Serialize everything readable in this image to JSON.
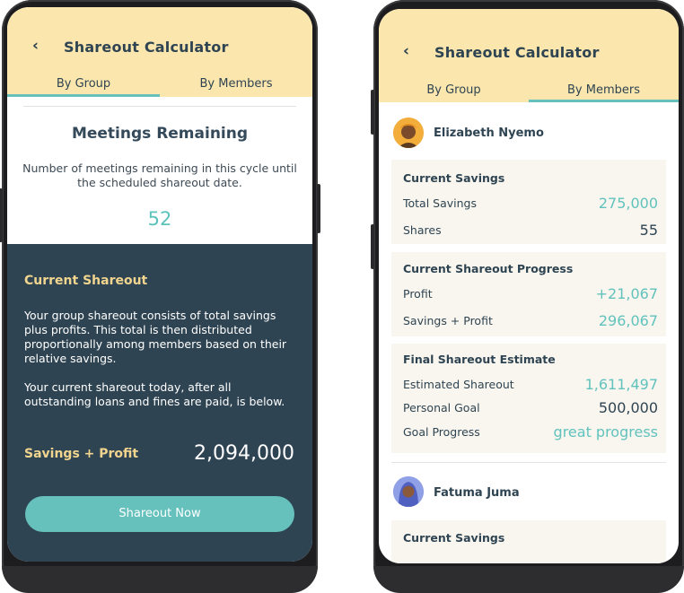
{
  "left_screen": {
    "header": {
      "title": "Shareout Calculator"
    },
    "tabs": [
      {
        "label": "By Group"
      },
      {
        "label": "By Members"
      }
    ],
    "meetings": {
      "title": "Meetings Remaining",
      "description": "Number of meetings remaining in this cycle until the scheduled shareout date.",
      "value": "52"
    },
    "current_shareout": {
      "title": "Current Shareout",
      "paragraph1": "Your group shareout consists of total savings plus profits. This total is then distributed proportionally among members based on their relative savings.",
      "paragraph2": "Your current shareout today, after all outstanding loans and fines are paid, is below.",
      "label": "Savings + Profit",
      "value": "2,094,000"
    },
    "cta": {
      "label": "Shareout Now"
    }
  },
  "right_screen": {
    "header": {
      "title": "Shareout Calculator"
    },
    "tabs": [
      {
        "label": "By Group"
      },
      {
        "label": "By Members"
      }
    ],
    "members": [
      {
        "name": "Elizabeth Nyemo",
        "current_savings": {
          "title": "Current Savings",
          "rows": [
            {
              "label": "Total Savings",
              "value": "275,000"
            },
            {
              "label": "Shares",
              "value": "55"
            }
          ]
        },
        "progress": {
          "title": "Current Shareout Progress",
          "rows": [
            {
              "label": "Profit",
              "value": "+21,067"
            },
            {
              "label": "Savings + Profit",
              "value": "296,067"
            }
          ]
        },
        "estimate": {
          "title": "Final Shareout Estimate",
          "rows": [
            {
              "label": "Estimated Shareout",
              "value": "1,611,497"
            },
            {
              "label": "Personal Goal",
              "value": "500,000"
            },
            {
              "label": "Goal Progress",
              "value": "great progress"
            }
          ]
        }
      },
      {
        "name": "Fatuma Juma",
        "current_savings": {
          "title": "Current Savings"
        }
      }
    ]
  },
  "colors": {
    "header_bg": "#fbe6ae",
    "dark_panel": "#2f4452",
    "accent_teal": "#66c1bd",
    "gold_text": "#f1d58f"
  },
  "icons": {
    "back": "chevron-left-icon"
  }
}
